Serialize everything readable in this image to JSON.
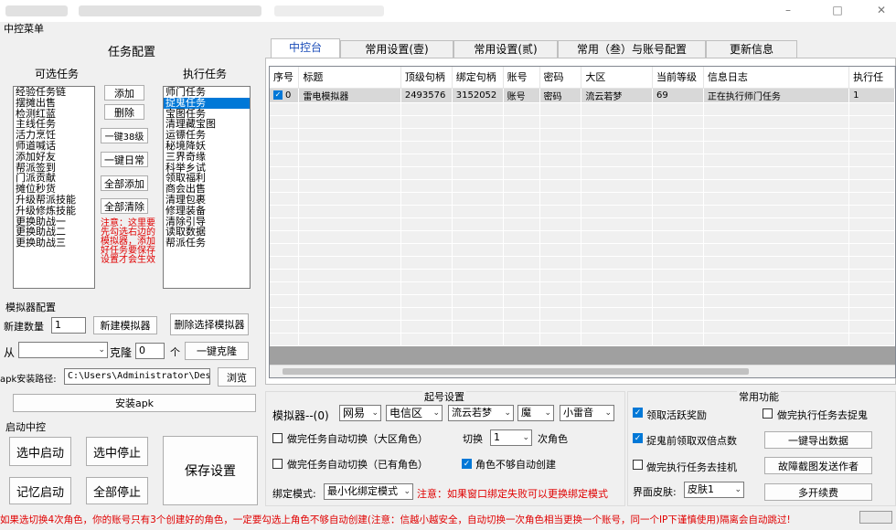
{
  "window": {
    "menu_title": "中控菜单"
  },
  "left": {
    "task_config_title": "任务配置",
    "available_title": "可选任务",
    "executing_title": "执行任务",
    "available_tasks": [
      "经验任务链",
      "摆摊出售",
      "检测红蓝",
      "主线任务",
      "活力烹饪",
      "师道喊话",
      "添加好友",
      "帮派签到",
      "门派贡献",
      "摊位秒货",
      "升级帮派技能",
      "升级修炼技能",
      "更换助战一",
      "更换助战二",
      "更换助战三"
    ],
    "executing_tasks": [
      "师门任务",
      "捉鬼任务",
      "宝图任务",
      "清理藏宝图",
      "运镖任务",
      "秘境降妖",
      "三界奇缘",
      "科举乡试",
      "领取福利",
      "商会出售",
      "清理包裹",
      "修理装备",
      "清除引导",
      "读取数据",
      "帮派任务"
    ],
    "selected_task": "捉鬼任务",
    "buttons": {
      "add": "添加",
      "delete": "删除",
      "level38": "一键38级",
      "daily": "一键日常",
      "add_all": "全部添加",
      "clear_all": "全部清除"
    },
    "note": "注意：这里要先勾选右边的模拟器，添加好任务要保存设置才会生效"
  },
  "emu": {
    "section_title": "模拟器配置",
    "new_count_label": "新建数量",
    "new_count_value": "1",
    "new_emu_btn": "新建模拟器",
    "delete_emu_btn": "删除选择模拟器",
    "from_label": "从",
    "clone_label": "克隆",
    "clone_value": "0",
    "unit_label": "个",
    "clone_btn": "一键克隆",
    "apk_path_label": "apk安装路径:",
    "apk_path_value": "C:\\Users\\Administrator\\Desk",
    "browse_btn": "浏览",
    "install_btn": "安装apk"
  },
  "start": {
    "section_title": "启动中控",
    "start_selected": "选中启动",
    "stop_selected": "选中停止",
    "memory_start": "记忆启动",
    "stop_all": "全部停止",
    "save_settings": "保存设置"
  },
  "tabs": [
    "中控台",
    "常用设置(壹)",
    "常用设置(贰)",
    "常用（叁）与账号配置",
    "更新信息"
  ],
  "table": {
    "columns": [
      "序号",
      "标题",
      "顶级句柄",
      "绑定句柄",
      "账号",
      "密码",
      "大区",
      "当前等级",
      "信息日志",
      "执行任"
    ],
    "rows": [
      {
        "idx": "0",
        "title": "雷电模拟器",
        "top_handle": "2493576",
        "bind_handle": "3152052",
        "account": "账号",
        "password": "密码",
        "region": "流云若梦",
        "level": "69",
        "log": "正在执行师门任务",
        "exec": "1"
      }
    ]
  },
  "login": {
    "section_title": "起号设置",
    "emu_label": "模拟器--(0)",
    "server": "网易",
    "zone": "电信区",
    "sub_server": "流云若梦",
    "school": "魔",
    "role": "小雷音",
    "auto_switch_big": "做完任务自动切换（大区角色）",
    "switch_label": "切换",
    "switch_value": "1",
    "next_role_label": "次角色",
    "auto_switch_have": "做完任务自动切换（已有角色）",
    "auto_create": "角色不够自动创建"
  },
  "bind": {
    "mode_label": "绑定模式:",
    "mode_value": "最小化绑定模式",
    "warning": "注意：如果窗口绑定失败可以更换绑定模式"
  },
  "common": {
    "section_title": "常用功能",
    "active_reward": "领取活跃奖励",
    "ghost_after": "做完执行任务去捉鬼",
    "double_points": "捉鬼前领取双倍点数",
    "export_btn": "一键导出数据",
    "hang_after": "做完执行任务去挂机",
    "report_btn": "故障截图发送作者",
    "skin_label": "界面皮肤:",
    "skin_value": "皮肤1",
    "renew_btn": "多开续费"
  },
  "footer": "如果选切换4次角色，你的账号只有3个创建好的角色，一定要勾选上角色不够自动创建(注意：信越小越安全，自动切换一次角色相当更换一个账号，同一个IP下谨慎使用)隔离会自动跳过!"
}
